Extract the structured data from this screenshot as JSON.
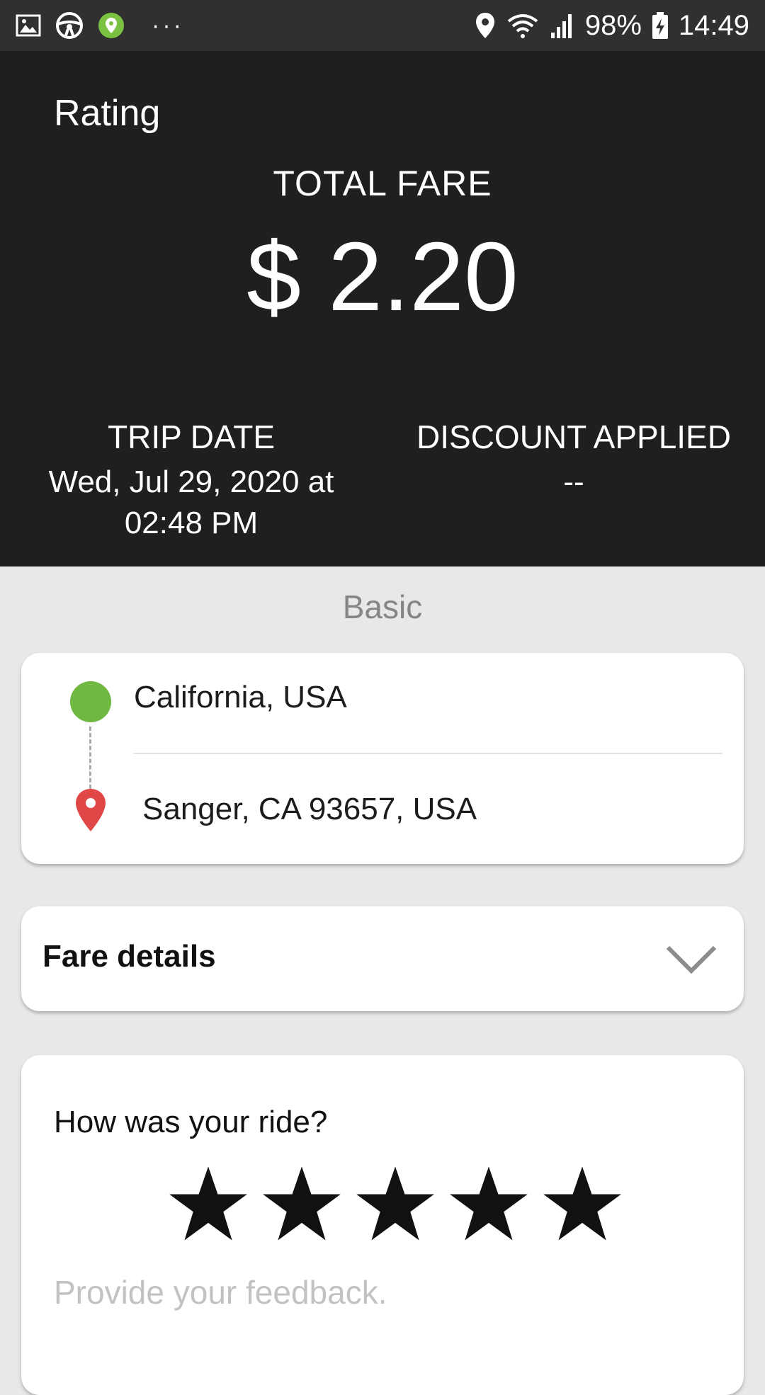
{
  "status_bar": {
    "battery": "98%",
    "time": "14:49",
    "dots": "···"
  },
  "header": {
    "title": "Rating",
    "fare_label": "TOTAL FARE",
    "fare_amount": "$ 2.20",
    "trip_date_label": "TRIP DATE",
    "trip_date_value": "Wed, Jul 29, 2020 at 02:48 PM",
    "discount_label": "DISCOUNT APPLIED",
    "discount_value": "--"
  },
  "ride_type": "Basic",
  "route": {
    "pickup": "California, USA",
    "dropoff": "Sanger, CA 93657, USA"
  },
  "fare_details": {
    "label": "Fare details"
  },
  "rating": {
    "question": "How was your ride?",
    "stars_total": 5,
    "stars_selected": 5,
    "feedback_placeholder": "Provide your feedback."
  },
  "colors": {
    "header_bg": "#1f1f1f",
    "status_bg": "#303030",
    "page_bg": "#e8e8e8",
    "pickup_green": "#6fb842",
    "dropoff_red": "#e04848"
  }
}
